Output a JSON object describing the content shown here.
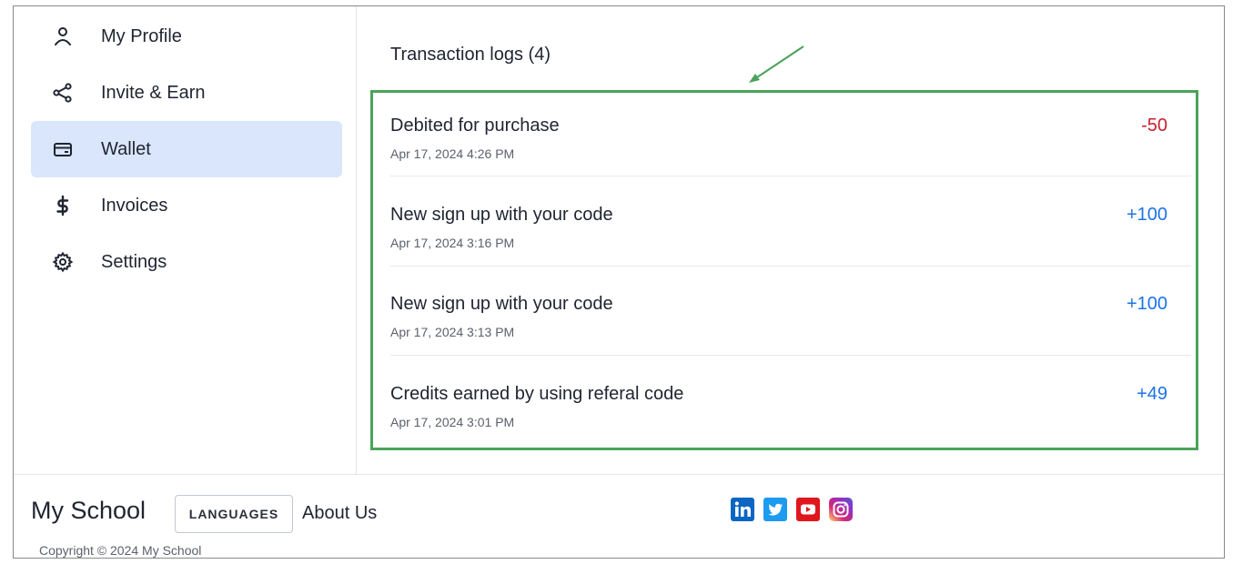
{
  "sidebar": {
    "items": [
      {
        "label": "My Profile",
        "icon": "user-icon",
        "active": false
      },
      {
        "label": "Invite & Earn",
        "icon": "share-icon",
        "active": false
      },
      {
        "label": "Wallet",
        "icon": "wallet-icon",
        "active": true
      },
      {
        "label": "Invoices",
        "icon": "dollar-icon",
        "active": false
      },
      {
        "label": "Settings",
        "icon": "gear-icon",
        "active": false
      }
    ]
  },
  "main": {
    "title": "Transaction logs (4)",
    "transactions": [
      {
        "title": "Debited for purchase",
        "date": "Apr 17, 2024 4:26 PM",
        "amount": "-50",
        "type": "debit"
      },
      {
        "title": "New sign up with your code",
        "date": "Apr 17, 2024 3:16 PM",
        "amount": "+100",
        "type": "credit"
      },
      {
        "title": "New sign up with your code",
        "date": "Apr 17, 2024 3:13 PM",
        "amount": "+100",
        "type": "credit"
      },
      {
        "title": "Credits earned by using referal code",
        "date": "Apr 17, 2024 3:01 PM",
        "amount": "+49",
        "type": "credit"
      }
    ]
  },
  "footer": {
    "brand": "My School",
    "languages_label": "LANGUAGES",
    "about_label": "About Us",
    "copyright": "Copyright © 2024 My School",
    "socials": [
      "linkedin-icon",
      "twitter-icon",
      "youtube-icon",
      "instagram-icon"
    ]
  },
  "colors": {
    "active_bg": "#d9e6fb",
    "debit": "#c8202f",
    "credit": "#1b73e8",
    "highlight_border": "#4aa35a"
  }
}
